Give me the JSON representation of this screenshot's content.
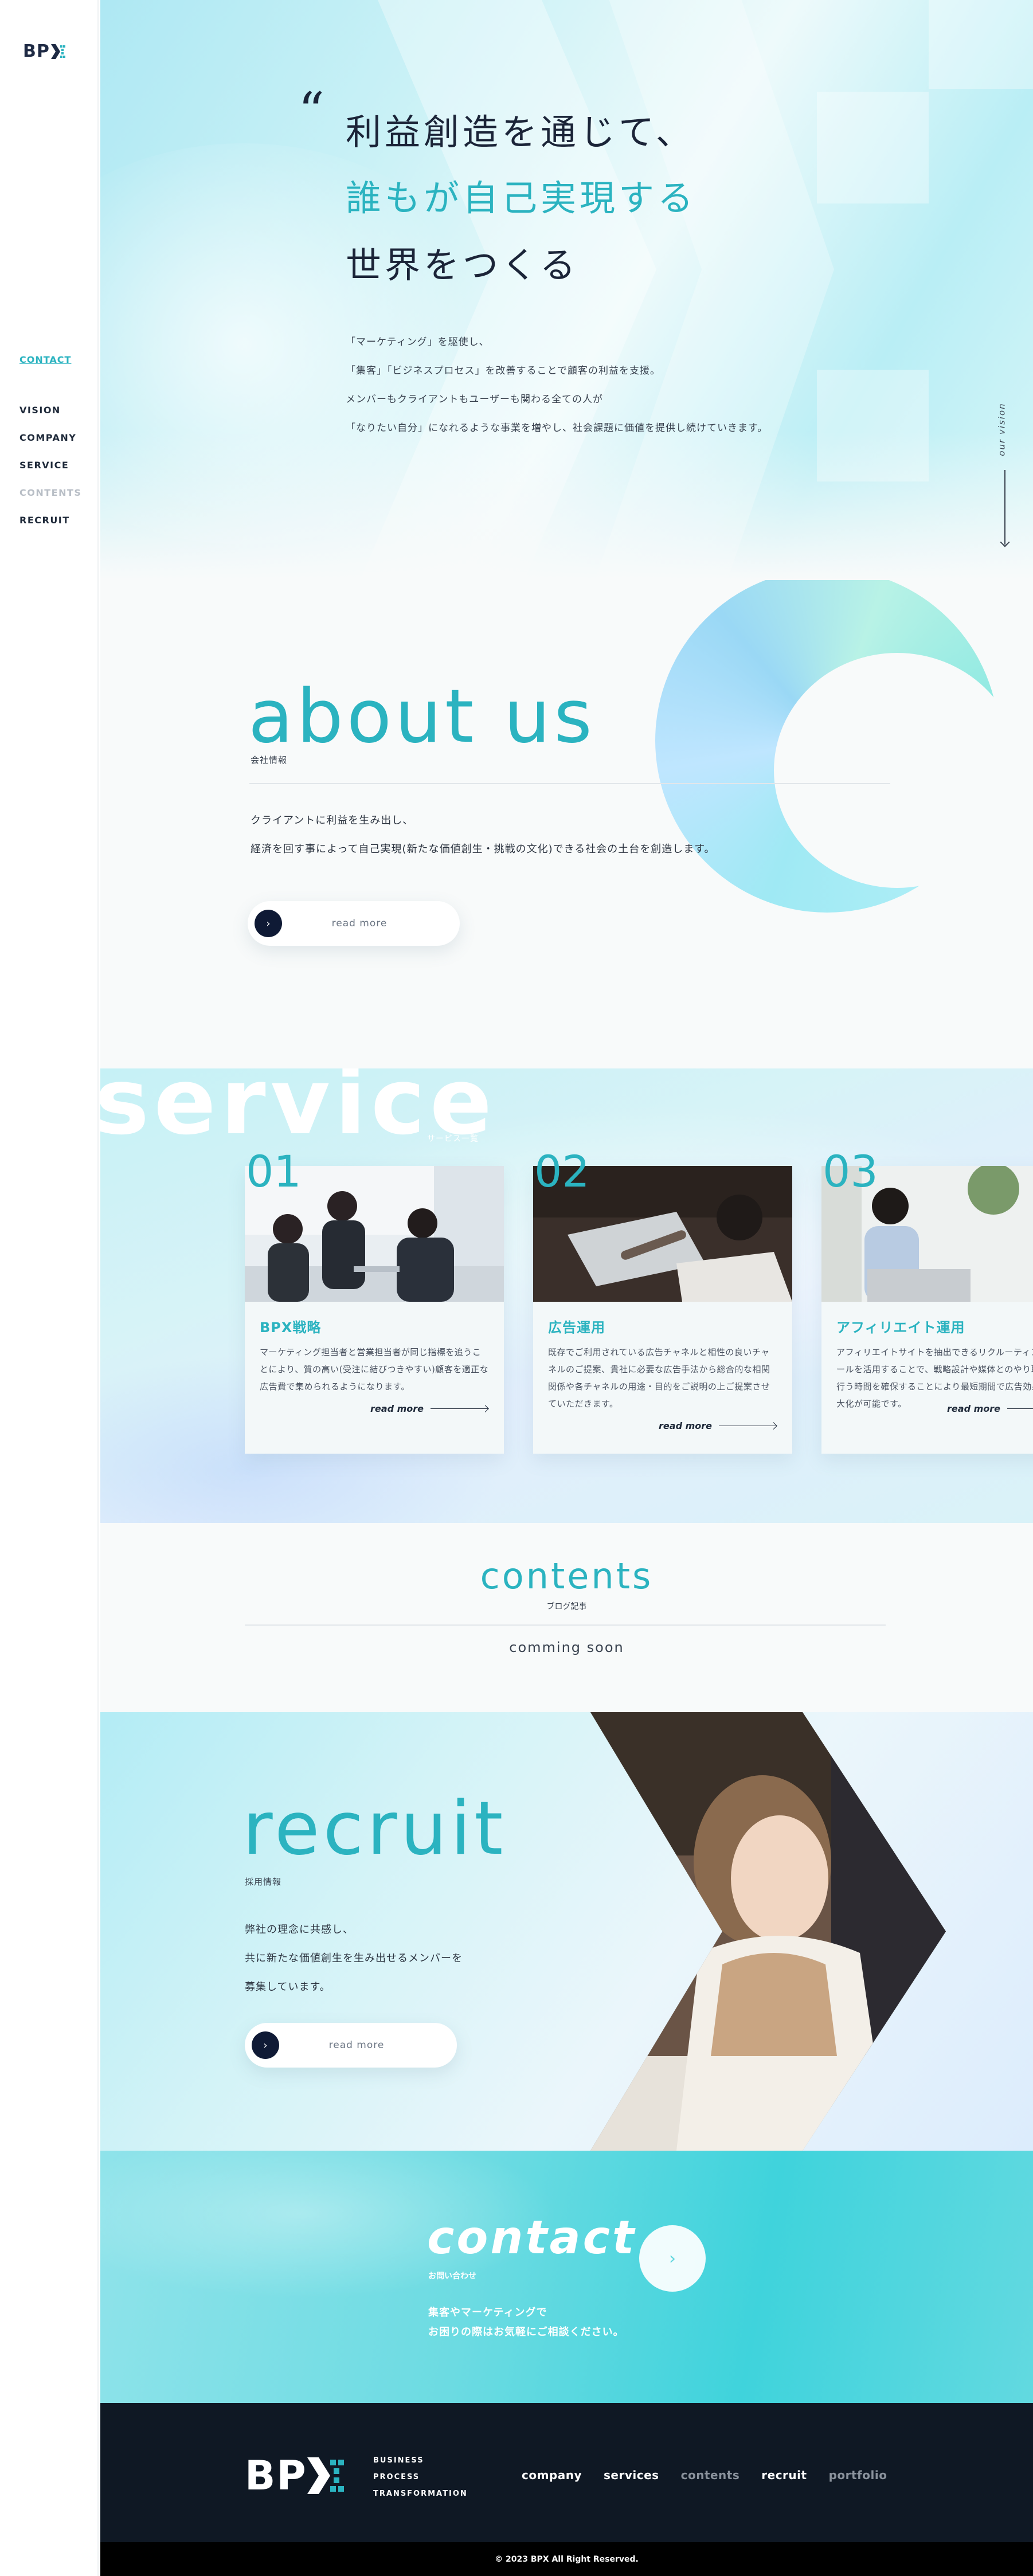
{
  "brand": {
    "logo_text": "BP",
    "logo_mark": "x-mark-icon"
  },
  "sidebar": {
    "contact_label": "CONTACT",
    "items": [
      {
        "label": "VISION",
        "active": false
      },
      {
        "label": "COMPANY",
        "active": false
      },
      {
        "label": "SERVICE",
        "active": false
      },
      {
        "label": "CONTENTS",
        "active": true
      },
      {
        "label": "RECRUIT",
        "active": false
      }
    ]
  },
  "hero": {
    "quote_mark": "“",
    "line1": "利益創造を通じて、",
    "line2": "誰もが自己実現する",
    "line3": "世界をつくる",
    "desc": [
      "「マーケティング」を駆使し、",
      "「集客」「ビジネスプロセス」を改善することで顧客の利益を支援。",
      "メンバーもクライアントもユーザーも関わる全ての人が",
      "「なりたい自分」になれるような事業を増やし、社会課題に価値を提供し続けていきます。"
    ],
    "vertical_label": "our vision"
  },
  "about": {
    "title": "about us",
    "subtitle": "会社情報",
    "body": [
      "クライアントに利益を生み出し、",
      "経済を回す事によって自己実現(新たな価値創生・挑戦の文化)できる社会の土台を創造します。"
    ],
    "read_more": "read more"
  },
  "service": {
    "title": "service",
    "subtitle": "サービス一覧",
    "cards": [
      {
        "num": "01",
        "title": "BPX戦略",
        "desc": "マーケティング担当者と営業担当者が同じ指標を追うことにより、質の高い(受注に結びつきやすい)顧客を適正な広告費で集められるようになります。",
        "more": "read more"
      },
      {
        "num": "02",
        "title": "広告運用",
        "desc": "既存でご利用されている広告チャネルと相性の良いチャネルのご提案、貴社に必要な広告手法から総合的な相関関係や各チャネルの用途・目的をご説明の上ご提案させていただきます。",
        "more": "read more"
      },
      {
        "num": "03",
        "title": "アフィリエイト運用",
        "desc": "アフィリエイトサイトを抽出できるリクルーティングツールを活用することで、戦略設計や媒体とのやり取りを行う時間を確保することにより最短期間で広告効果の最大化が可能です。",
        "more": "read more"
      }
    ]
  },
  "contents": {
    "title": "contents",
    "subtitle": "ブログ記事",
    "status": "comming soon"
  },
  "recruit": {
    "title": "recruit",
    "subtitle": "採用情報",
    "body": [
      "弊社の理念に共感し、",
      "共に新たな価値創生を生み出せるメンバーを",
      "募集しています。"
    ],
    "read_more": "read more"
  },
  "contact": {
    "title": "contact",
    "subtitle": "お問い合わせ",
    "body": [
      "集客やマーケティングで",
      "お困りの際はお気軽にご相談ください。"
    ],
    "button_icon": "chevron-right-icon"
  },
  "footer": {
    "logo_text": "BP",
    "tagline": [
      "BUSINESS",
      "PROCESS",
      "TRANSFORMATION"
    ],
    "nav": [
      {
        "label": "company",
        "dim": false
      },
      {
        "label": "services",
        "dim": false
      },
      {
        "label": "contents",
        "dim": true
      },
      {
        "label": "recruit",
        "dim": false
      },
      {
        "label": "portfolio",
        "dim": true
      }
    ],
    "copyright": "© 2023 BPX All Right Reserved."
  },
  "colors": {
    "accent": "#2bb3c0",
    "dark": "#0f1824",
    "navy": "#0f1a35"
  }
}
